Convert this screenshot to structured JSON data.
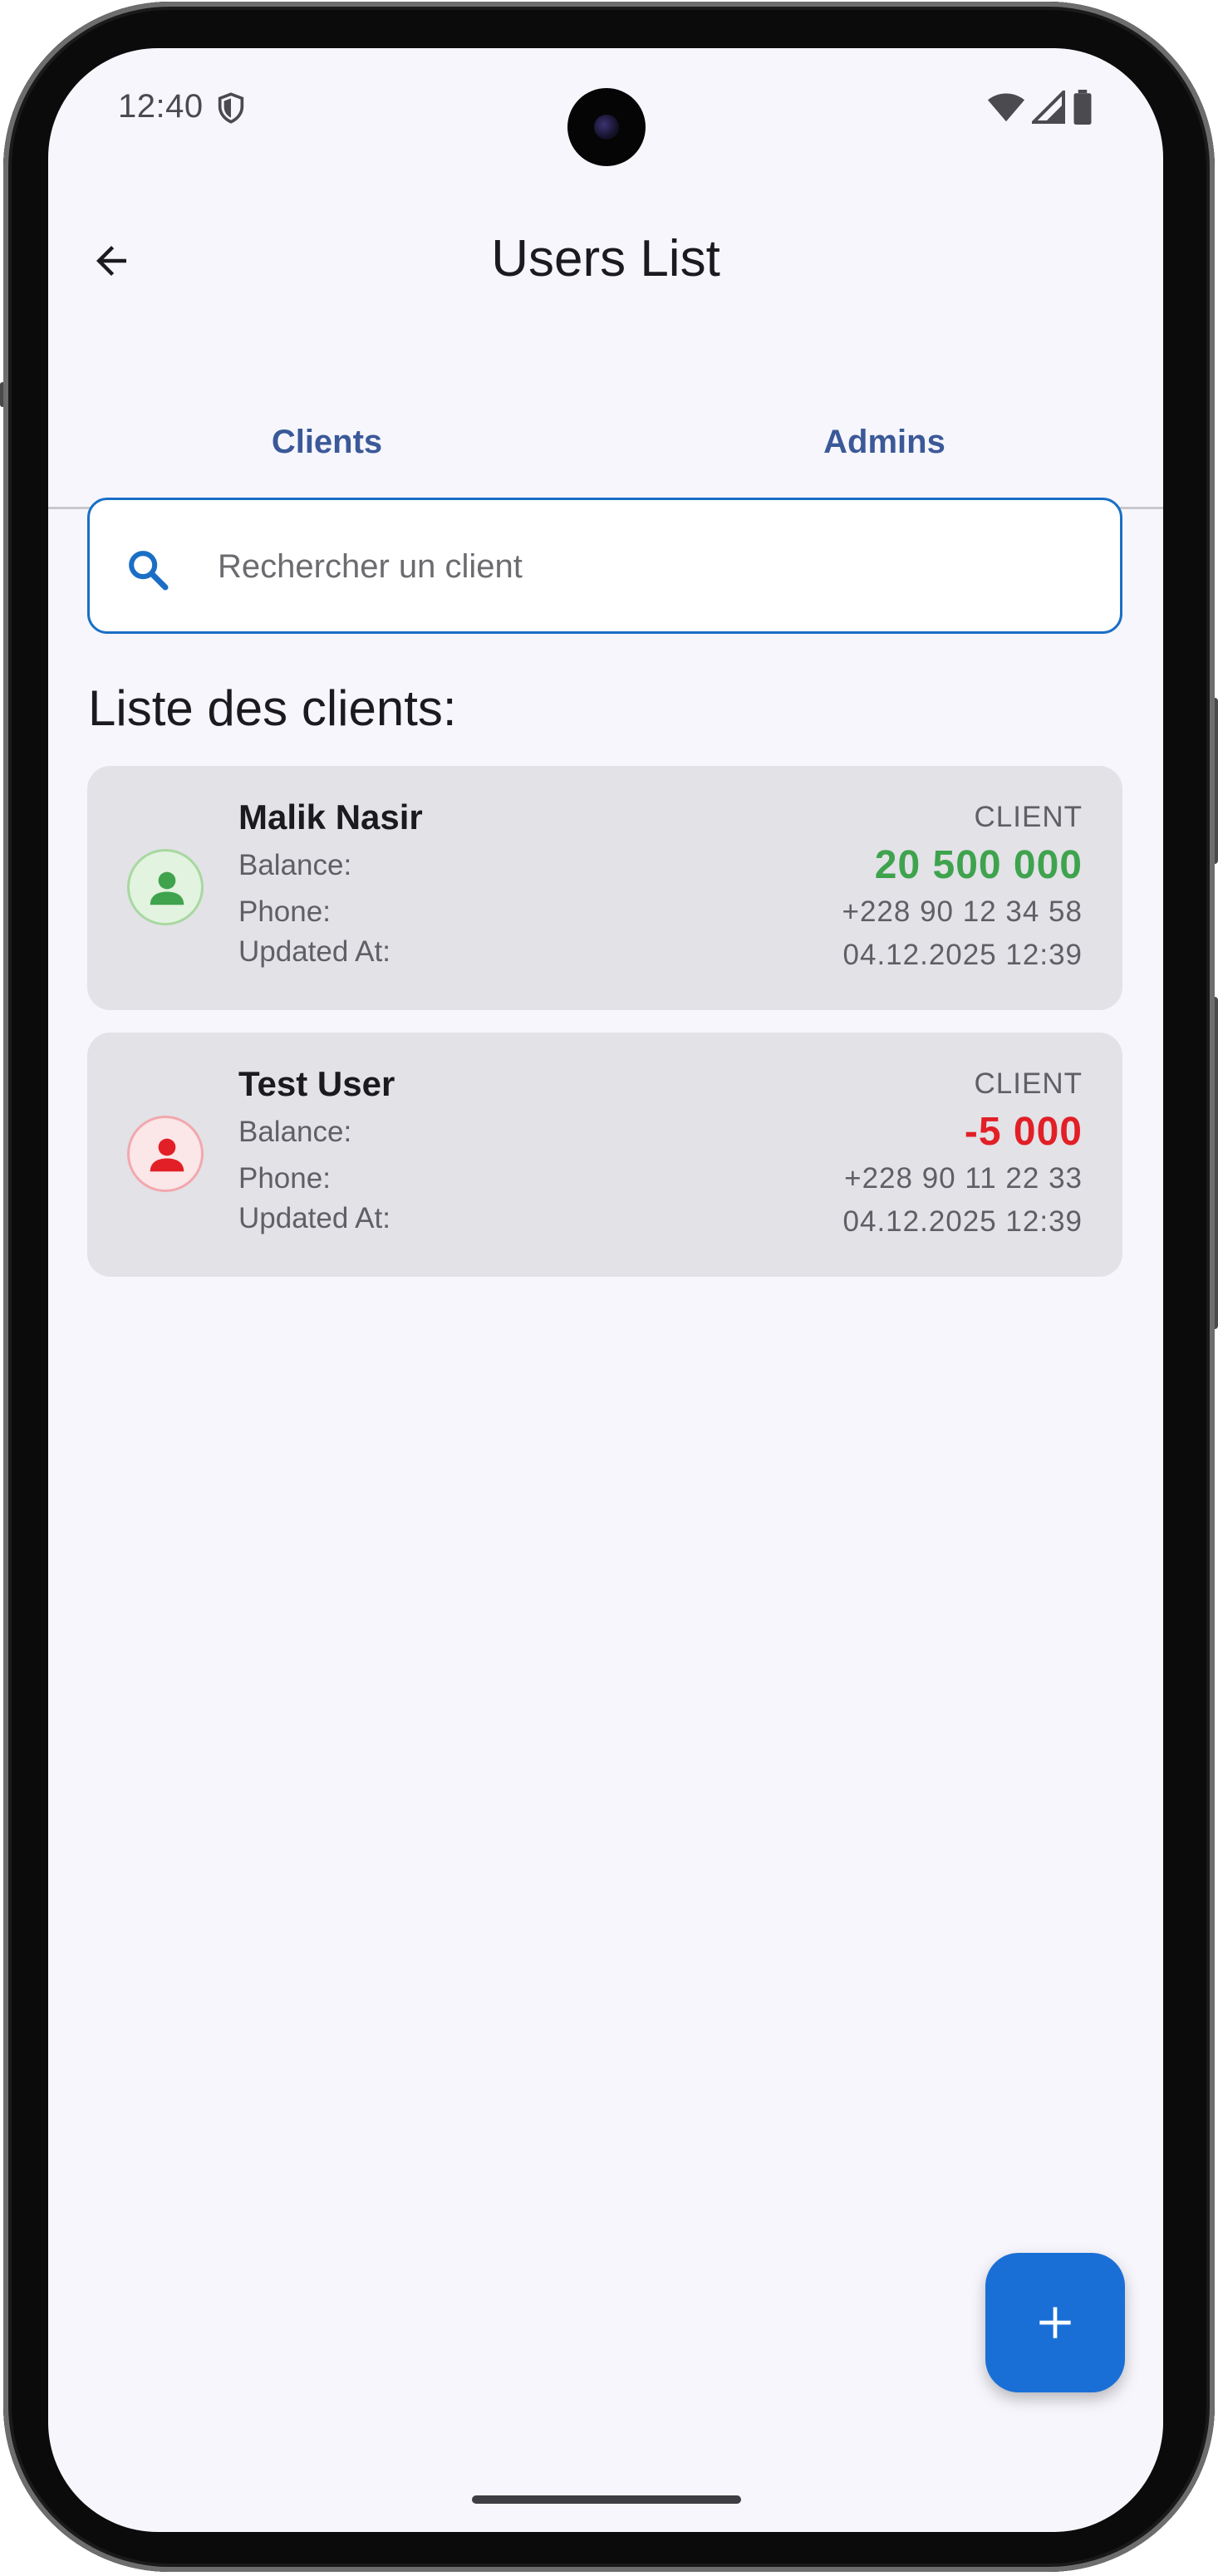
{
  "status_bar": {
    "time": "12:40"
  },
  "app_bar": {
    "title": "Users List"
  },
  "tabs": [
    {
      "label": "Clients",
      "selected": true
    },
    {
      "label": "Admins",
      "selected": false
    }
  ],
  "search": {
    "placeholder": "Rechercher un client",
    "value": ""
  },
  "section_title": "Liste des clients:",
  "field_labels": {
    "balance": "Balance:",
    "phone": "Phone:",
    "updated_at": "Updated At:"
  },
  "clients": [
    {
      "name": "Malik Nasir",
      "role": "CLIENT",
      "balance": "20 500 000",
      "phone": "+228 90 12 34 58",
      "updated_at": "04.12.2025 12:39",
      "status": "positive"
    },
    {
      "name": "Test User",
      "role": "CLIENT",
      "balance": "-5 000",
      "phone": "+228 90 11 22 33",
      "updated_at": "04.12.2025 12:39",
      "status": "negative"
    }
  ],
  "icons": {
    "back": "arrow-left-icon",
    "search": "search-icon",
    "avatar": "person-icon",
    "fab": "plus-icon"
  },
  "colors": {
    "accent": "#1a6fd6",
    "tab_selected": "#3b5998",
    "positive": "#3fa34d",
    "negative": "#e21f26",
    "screen_bg": "#f6f6fc",
    "card_bg": "#e2e2e7"
  }
}
